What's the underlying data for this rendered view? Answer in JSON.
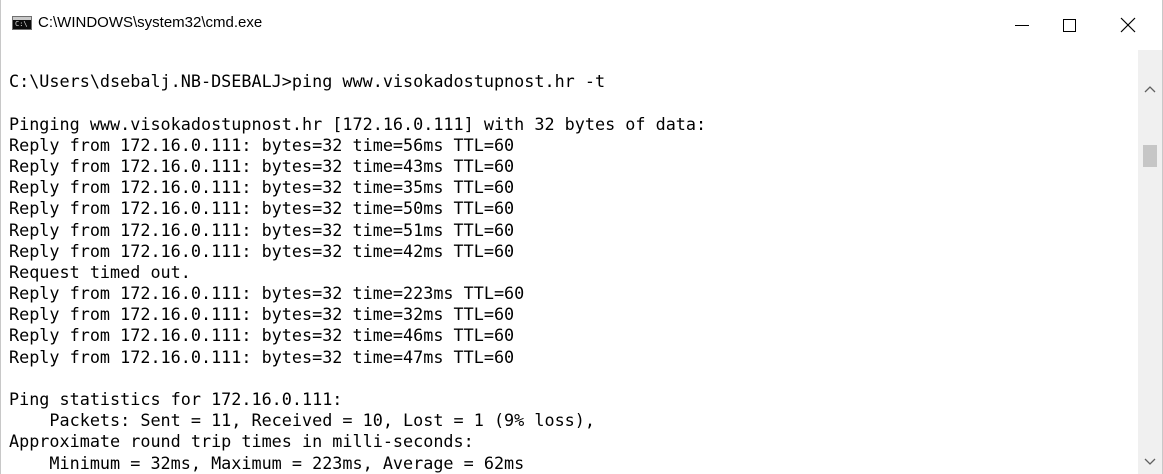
{
  "window": {
    "title": "C:\\WINDOWS\\system32\\cmd.exe",
    "icon_name": "cmd-console-icon",
    "icon_prompt": "C:\\",
    "controls": {
      "minimize_icon": "minimize-icon",
      "maximize_icon": "maximize-icon",
      "close_icon": "close-icon"
    }
  },
  "console": {
    "lines": [
      "",
      "C:\\Users\\dsebalj.NB-DSEBALJ>ping www.visokadostupnost.hr -t",
      "",
      "Pinging www.visokadostupnost.hr [172.16.0.111] with 32 bytes of data:",
      "Reply from 172.16.0.111: bytes=32 time=56ms TTL=60",
      "Reply from 172.16.0.111: bytes=32 time=43ms TTL=60",
      "Reply from 172.16.0.111: bytes=32 time=35ms TTL=60",
      "Reply from 172.16.0.111: bytes=32 time=50ms TTL=60",
      "Reply from 172.16.0.111: bytes=32 time=51ms TTL=60",
      "Reply from 172.16.0.111: bytes=32 time=42ms TTL=60",
      "Request timed out.",
      "Reply from 172.16.0.111: bytes=32 time=223ms TTL=60",
      "Reply from 172.16.0.111: bytes=32 time=32ms TTL=60",
      "Reply from 172.16.0.111: bytes=32 time=46ms TTL=60",
      "Reply from 172.16.0.111: bytes=32 time=47ms TTL=60",
      "",
      "Ping statistics for 172.16.0.111:",
      "    Packets: Sent = 11, Received = 10, Lost = 1 (9% loss),",
      "Approximate round trip times in milli-seconds:",
      "    Minimum = 32ms, Maximum = 223ms, Average = 62ms"
    ]
  },
  "scrollbar": {
    "up_icon": "scroll-up-arrow-icon",
    "down_icon": "scroll-down-arrow-icon"
  },
  "colors": {
    "console_background": "#ffffff",
    "console_text": "#000000",
    "scrollbar_track": "#f0f0f0",
    "scrollbar_thumb": "#c6c6c6"
  }
}
